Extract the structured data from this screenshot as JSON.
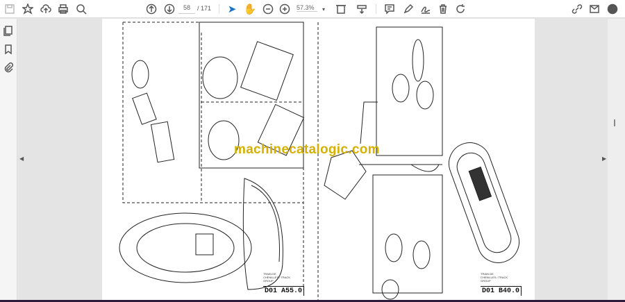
{
  "toolbar": {
    "left_icons": [
      "save-icon",
      "bookmark-star-icon",
      "upload-cloud-icon",
      "print-icon",
      "find-zoom-icon"
    ],
    "nav": {
      "current_page": "58",
      "total_pages": "/ 171"
    },
    "zoom": "57.3%",
    "right_icons": [
      "comment-icon",
      "highlight-pen-icon",
      "sign-icon",
      "delete-icon",
      "rotate-icon"
    ],
    "far_right_icons": [
      "share-link-icon",
      "email-icon",
      "account-icon"
    ]
  },
  "sidebar": {
    "icons": [
      "page-thumbnails-icon",
      "bookmarks-icon",
      "attachments-icon"
    ]
  },
  "document": {
    "watermark": "machinecatalogic.com",
    "left_page_code": "D01 A55.0",
    "right_page_code": "D01 B40.0",
    "left_caption": "TRAIN DE CHENILLES / TRACK GROUP",
    "right_caption": "TRAIN DE CHENILLES / TRACK GROUP"
  },
  "colors": {
    "accent": "#1a73c8",
    "watermark": "#d4b100"
  }
}
